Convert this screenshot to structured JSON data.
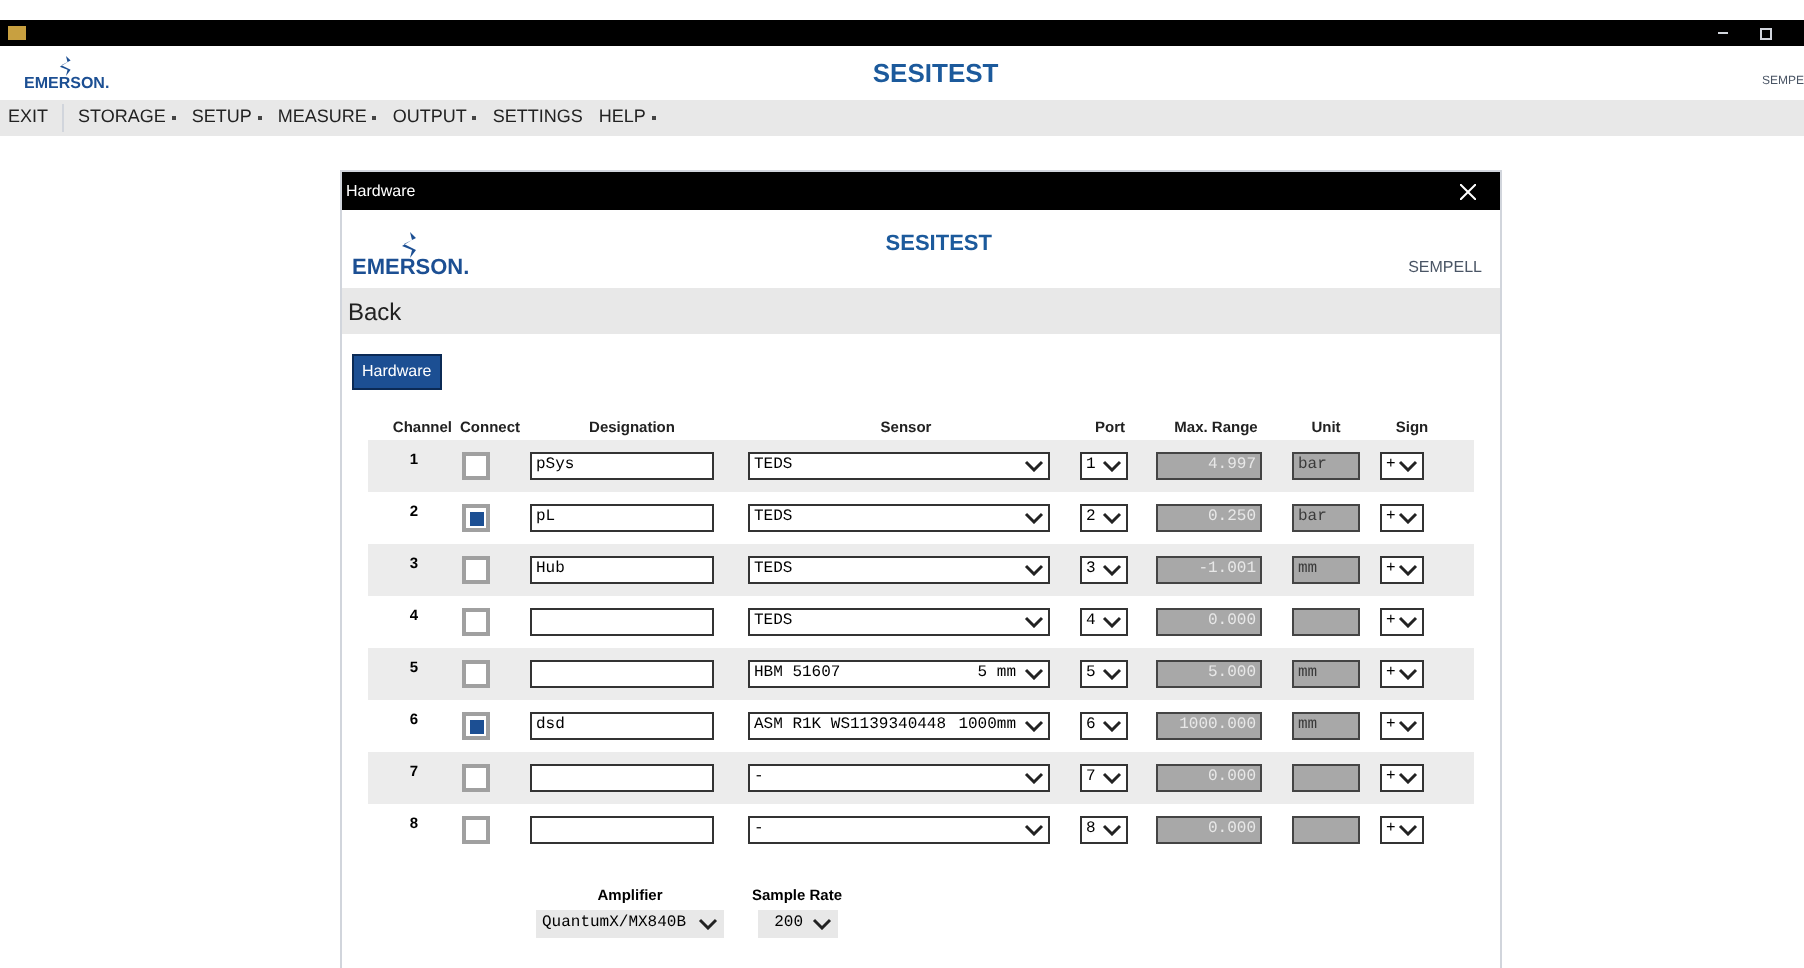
{
  "app_header": {
    "logo_text": "EMERSON.",
    "title": "SESITEST",
    "brand": "SEMPE"
  },
  "menu": [
    {
      "label": "EXIT",
      "has_dropdown": false
    },
    {
      "label": "STORAGE",
      "has_dropdown": true
    },
    {
      "label": "SETUP",
      "has_dropdown": true
    },
    {
      "label": "MEASURE",
      "has_dropdown": true
    },
    {
      "label": "OUTPUT",
      "has_dropdown": true
    },
    {
      "label": "SETTINGS",
      "has_dropdown": false
    },
    {
      "label": "HELP",
      "has_dropdown": true
    }
  ],
  "dialog": {
    "title": "Hardware",
    "logo_text": "EMERSON.",
    "header_title": "SESITEST",
    "brand": "SEMPELL",
    "back": "Back",
    "tab": "Hardware",
    "columns": [
      "Channel",
      "Connect",
      "Designation",
      "Sensor",
      "Port",
      "Max. Range",
      "Unit",
      "Sign"
    ],
    "rows": [
      {
        "channel": "1",
        "checked": false,
        "designation": "pSys",
        "sensor": "TEDS",
        "port": "1",
        "max_range": "4.997",
        "unit": "bar",
        "sign": "+"
      },
      {
        "channel": "2",
        "checked": true,
        "designation": "pL",
        "sensor": "TEDS",
        "port": "2",
        "max_range": "0.250",
        "unit": "bar",
        "sign": "+"
      },
      {
        "channel": "3",
        "checked": false,
        "designation": "Hub",
        "sensor": "TEDS",
        "port": "3",
        "max_range": "-1.001",
        "unit": "mm",
        "sign": "+"
      },
      {
        "channel": "4",
        "checked": false,
        "designation": "",
        "sensor": "TEDS",
        "port": "4",
        "max_range": "0.000",
        "unit": "",
        "sign": "+"
      },
      {
        "channel": "5",
        "checked": false,
        "designation": "",
        "sensor": "HBM 51607",
        "sensor_range": "5 mm",
        "port": "5",
        "max_range": "5.000",
        "unit": "mm",
        "sign": "+"
      },
      {
        "channel": "6",
        "checked": true,
        "designation": "dsd",
        "sensor": "ASM R1K WS1139340448",
        "sensor_range": "1000mm",
        "port": "6",
        "max_range": "1000.000",
        "unit": "mm",
        "sign": "+"
      },
      {
        "channel": "7",
        "checked": false,
        "designation": "",
        "sensor": "-",
        "port": "7",
        "max_range": "0.000",
        "unit": "",
        "sign": "+"
      },
      {
        "channel": "8",
        "checked": false,
        "designation": "",
        "sensor": "-",
        "port": "8",
        "max_range": "0.000",
        "unit": "",
        "sign": "+"
      }
    ],
    "amplifier": {
      "label": "Amplifier",
      "value": "QuantumX/MX840B"
    },
    "sample_rate": {
      "label": "Sample Rate",
      "value": "200"
    }
  }
}
